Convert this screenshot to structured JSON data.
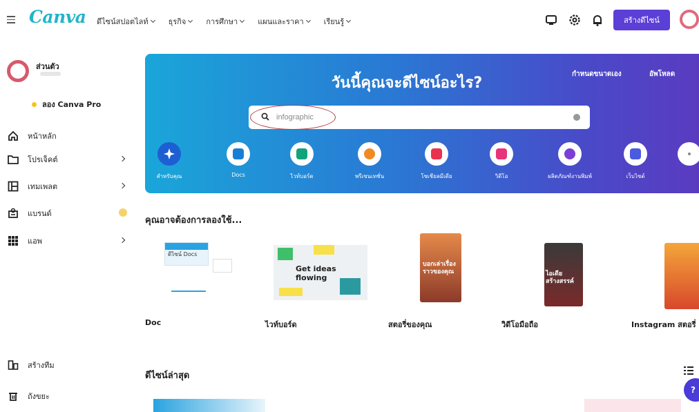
{
  "app": {
    "logo": "Canva",
    "nav": [
      {
        "label": "ดีไซน์สปอตไลท์"
      },
      {
        "label": "ธุรกิจ"
      },
      {
        "label": "การศึกษา"
      },
      {
        "label": "แผนและราคา"
      },
      {
        "label": "เรียนรู้"
      }
    ],
    "create_label": "สร้างดีไซน์",
    "icons": [
      "desktop-icon",
      "settings-icon",
      "bell-icon"
    ]
  },
  "sidebar": {
    "profile_name": "ส่วนตัว",
    "pro_label": "ลอง Canva Pro",
    "items": [
      {
        "label": "หน้าหลัก",
        "icon": "home-icon",
        "arrow": false
      },
      {
        "label": "โปรเจ็คต์",
        "icon": "folder-icon",
        "arrow": true
      },
      {
        "label": "เทมเพลต",
        "icon": "template-icon",
        "arrow": true
      },
      {
        "label": "แบรนด์",
        "icon": "brand-icon",
        "arrow": false
      },
      {
        "label": "แอพ",
        "icon": "apps-icon",
        "arrow": true
      }
    ],
    "bottom_items": [
      {
        "label": "สร้างทีม",
        "icon": "team-icon"
      },
      {
        "label": "ถังขยะ",
        "icon": "trash-icon"
      }
    ]
  },
  "hero": {
    "title": "วันนี้คุณจะดีไซน์อะไร?",
    "link_custom_size": "กำหนดขนาดเอง",
    "link_upload": "อัพโหลด",
    "search_value": "infographic",
    "categories": [
      {
        "label": "สำหรับคุณ",
        "color": "#1f6fd8"
      },
      {
        "label": "Docs",
        "color": "#1a7fd4"
      },
      {
        "label": "ไวท์บอร์ด",
        "color": "#13a37a"
      },
      {
        "label": "พรีเซนเทชั่น",
        "color": "#f08a24"
      },
      {
        "label": "โซเชียลมีเดีย",
        "color": "#e8334f"
      },
      {
        "label": "วิดีโอ",
        "color": "#e8337a"
      },
      {
        "label": "ผลิตภัณฑ์งานพิมพ์",
        "color": "#7b3fd6"
      },
      {
        "label": "เว็บไซต์",
        "color": "#4a5be0"
      }
    ]
  },
  "suggestions": {
    "title": "คุณอาจต้องการลองใช้...",
    "cards": [
      {
        "label": "Doc",
        "thumb_text": "ดีไซน์ Docs"
      },
      {
        "label": "ไวท์บอร์ด",
        "thumb_text": "Get ideas flowing"
      },
      {
        "label": "สตอรี่ของคุณ",
        "thumb_text": "บอกเล่าเรื่องราวของคุณ"
      },
      {
        "label": "วิดีโอมือถือ",
        "thumb_text": "ไอเดียสร้างสรรค์"
      },
      {
        "label": "Instagram สตอรี่",
        "thumb_text": ""
      }
    ]
  },
  "recent": {
    "title": "ดีไซน์ล่าสุด"
  },
  "colors": {
    "accent": "#5b3fd6",
    "logo": "#1fb6c9",
    "annotation": "#b33b3b"
  }
}
